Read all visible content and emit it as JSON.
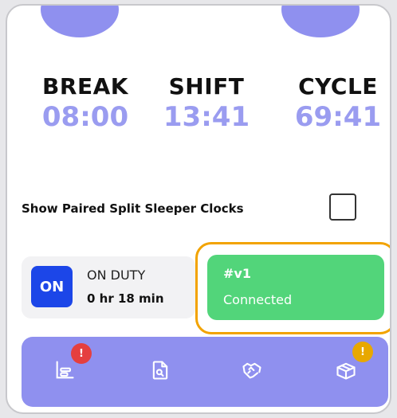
{
  "clocks": [
    {
      "label": "BREAK",
      "value": "08:00"
    },
    {
      "label": "SHIFT",
      "value": "13:41"
    },
    {
      "label": "CYCLE",
      "value": "69:41"
    }
  ],
  "split_sleeper": {
    "label": "Show Paired Split Sleeper Clocks",
    "checked": false
  },
  "duty": {
    "badge": "ON",
    "status": "ON DUTY",
    "time": "0 hr 18 min"
  },
  "connection": {
    "id": "#v1",
    "status": "Connected"
  },
  "nav": {
    "items": [
      {
        "icon": "logs-icon",
        "badge": "!",
        "badge_color": "#e53f3f"
      },
      {
        "icon": "document-search-icon"
      },
      {
        "icon": "handshake-icon"
      },
      {
        "icon": "package-icon",
        "badge": "!",
        "badge_color": "#e8a800"
      }
    ]
  },
  "colors": {
    "accent": "#8f90ef",
    "clock_value": "#9a9cf0",
    "on_badge": "#1c46e8",
    "connected": "#52d57a",
    "highlight": "#f2a300"
  }
}
